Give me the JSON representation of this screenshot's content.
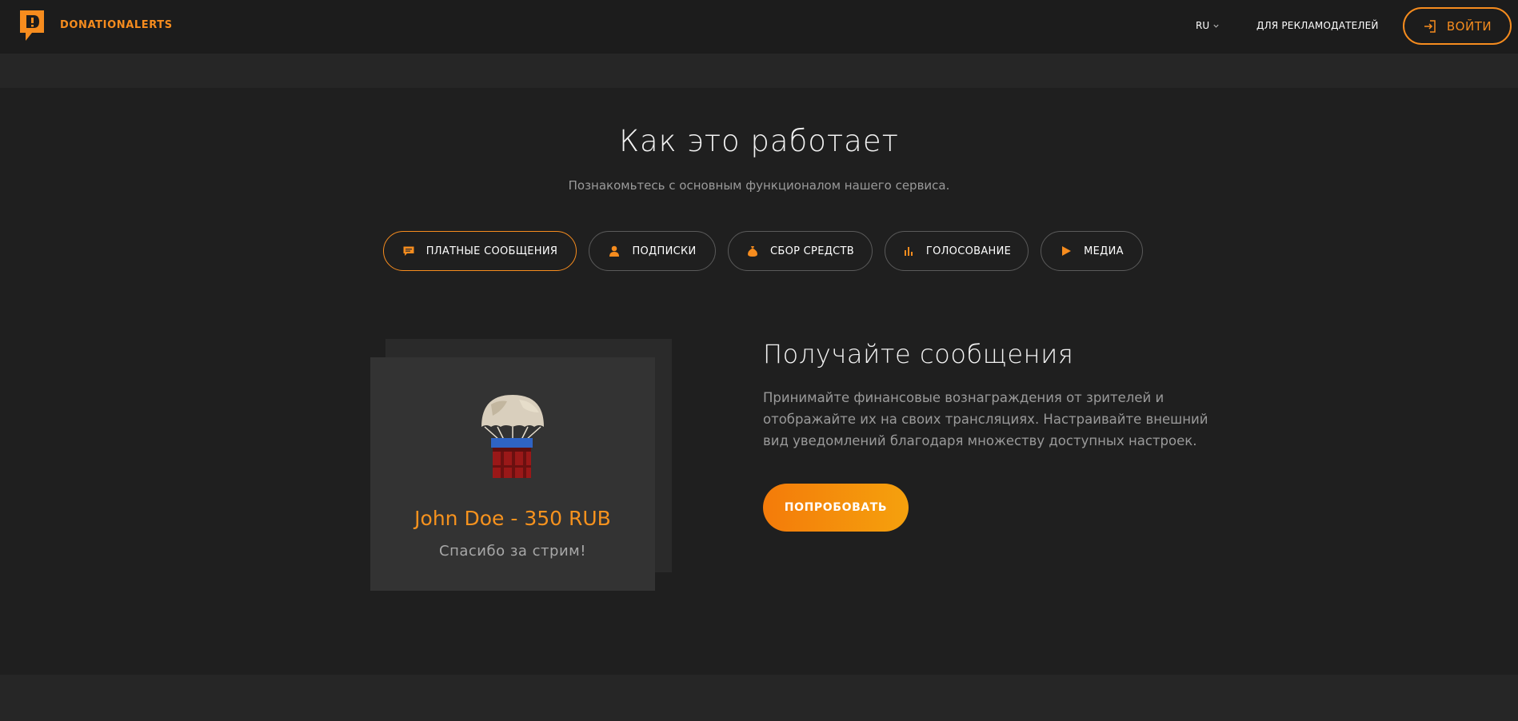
{
  "header": {
    "brand": "DONATIONALERTS",
    "lang": "RU",
    "advertisers": "ДЛЯ РЕКЛАМОДАТЕЛЕЙ",
    "login": "ВОЙТИ"
  },
  "section": {
    "title": "Как это работает",
    "subtitle": "Познакомьтесь с основным функционалом нашего сервиса."
  },
  "tabs": [
    {
      "label": "ПЛАТНЫЕ СООБЩЕНИЯ",
      "icon": "message-icon",
      "active": true
    },
    {
      "label": "ПОДПИСКИ",
      "icon": "user-icon",
      "active": false
    },
    {
      "label": "СБОР СРЕДСТВ",
      "icon": "money-bag-icon",
      "active": false
    },
    {
      "label": "ГОЛОСОВАНИЕ",
      "icon": "bar-chart-icon",
      "active": false
    },
    {
      "label": "МЕДИА",
      "icon": "play-icon",
      "active": false
    }
  ],
  "preview": {
    "name": "John Doe - 350 RUB",
    "message": "Спасибо за стрим!"
  },
  "feature": {
    "title": "Получайте сообщения",
    "text": "Принимайте финансовые вознаграждения от зрителей и отображайте их на своих трансляциях. Настраивайте внешний вид уведомлений благодаря множеству доступных настроек.",
    "button": "ПОПРОБОВАТЬ"
  },
  "colors": {
    "accent": "#f68c1e",
    "background": "#1f1f1f",
    "header": "#1c1c1c",
    "card": "#333333"
  }
}
